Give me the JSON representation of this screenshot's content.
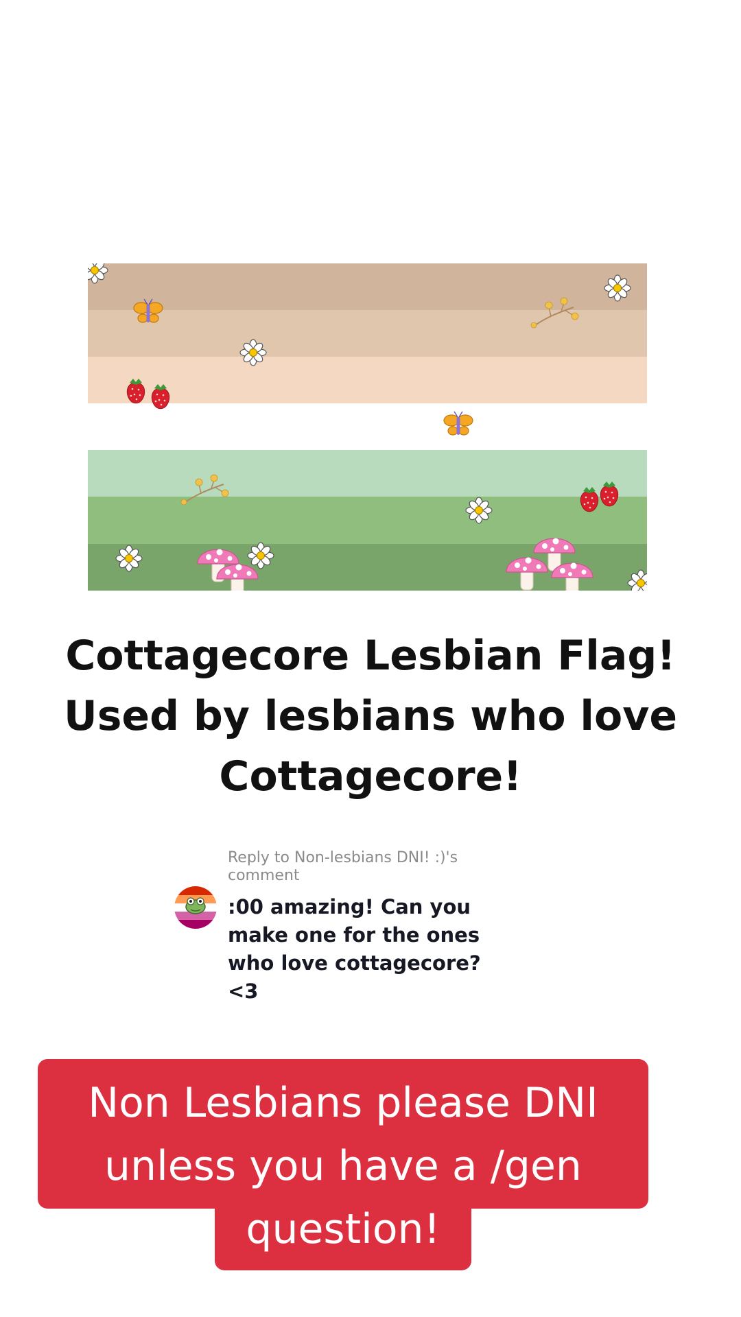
{
  "flag": {
    "stripe_colors": [
      "#d0b49b",
      "#e0c6ad",
      "#f5d8c2",
      "#ffffff",
      "#b7dbbc",
      "#8fbe7f",
      "#7aa56a"
    ],
    "decorations": [
      "daisy",
      "butterfly",
      "strawberry",
      "flower-sprig",
      "mushroom"
    ]
  },
  "headline": {
    "line1": "Cottagecore Lesbian Flag!",
    "line2": "Used by lesbians who love",
    "line3": "Cottagecore!"
  },
  "comment": {
    "reply_to_line1": "Reply to Non-lesbians DNI! :)'s",
    "reply_to_line2": "comment",
    "text_line1": ":00 amazing! Can you",
    "text_line2": "make one for the ones",
    "text_line3": "who love cottagecore?",
    "text_line4": "<3",
    "avatar_colors": [
      "#d62900",
      "#ff9b55",
      "#ffffff",
      "#d462a6",
      "#a50062"
    ]
  },
  "caption": {
    "line1": "Non Lesbians please DNI",
    "line2": "unless you have a /gen",
    "line3": "question!",
    "background_color": "#dc3040"
  }
}
